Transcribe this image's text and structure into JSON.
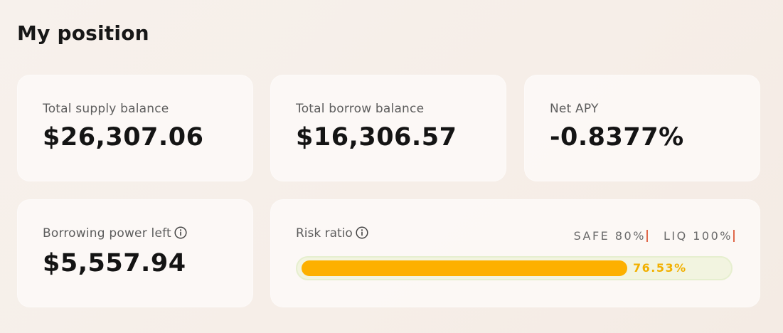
{
  "header": {
    "title": "My position"
  },
  "cards": {
    "supply": {
      "label": "Total supply balance",
      "value": "$26,307.06"
    },
    "borrow": {
      "label": "Total borrow balance",
      "value": "$16,306.57"
    },
    "net_apy": {
      "label": "Net APY",
      "value": "-0.8377%"
    },
    "borrowing_power": {
      "label": "Borrowing power left",
      "value": "$5,557.94",
      "icon": "info-icon"
    }
  },
  "risk": {
    "label": "Risk ratio",
    "icon": "info-icon",
    "safe_label": "SAFE 80%",
    "liq_label": "LIQ 100%",
    "ratio_text": "76.53%",
    "ratio_value": 0.7653,
    "fill_color": "#fdb000",
    "marker_color": "#e0684a"
  }
}
